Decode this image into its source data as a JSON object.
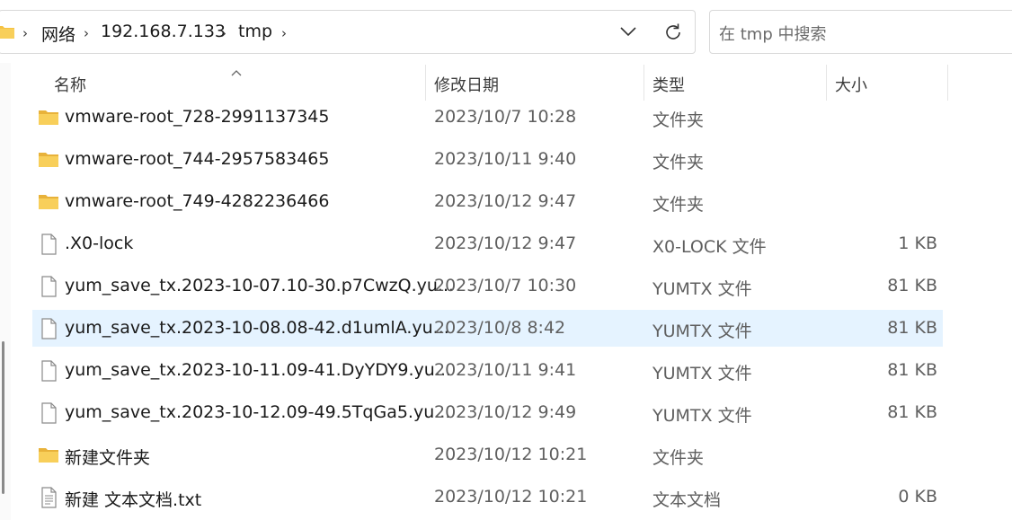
{
  "address": {
    "crumbs": [
      "网络",
      "192.168.7.133",
      "tmp"
    ]
  },
  "search": {
    "placeholder": "在 tmp 中搜索"
  },
  "columns": {
    "name": "名称",
    "date": "修改日期",
    "type": "类型",
    "size": "大小"
  },
  "files": [
    {
      "name": "vmware-root_728-2991137345",
      "date": "2023/10/7 10:28",
      "type": "文件夹",
      "size": "",
      "icon": "folder-icon"
    },
    {
      "name": "vmware-root_744-2957583465",
      "date": "2023/10/11 9:40",
      "type": "文件夹",
      "size": "",
      "icon": "folder-icon"
    },
    {
      "name": "vmware-root_749-4282236466",
      "date": "2023/10/12 9:47",
      "type": "文件夹",
      "size": "",
      "icon": "folder-icon"
    },
    {
      "name": ".X0-lock",
      "date": "2023/10/12 9:47",
      "type": "X0-LOCK 文件",
      "size": "1 KB",
      "icon": "file-icon"
    },
    {
      "name": "yum_save_tx.2023-10-07.10-30.p7CwzQ.yu...",
      "date": "2023/10/7 10:30",
      "type": "YUMTX 文件",
      "size": "81 KB",
      "icon": "file-icon"
    },
    {
      "name": "yum_save_tx.2023-10-08.08-42.d1umlA.yu...",
      "date": "2023/10/8 8:42",
      "type": "YUMTX 文件",
      "size": "81 KB",
      "icon": "file-icon",
      "selected": true
    },
    {
      "name": "yum_save_tx.2023-10-11.09-41.DyYDY9.yu...",
      "date": "2023/10/11 9:41",
      "type": "YUMTX 文件",
      "size": "81 KB",
      "icon": "file-icon"
    },
    {
      "name": "yum_save_tx.2023-10-12.09-49.5TqGa5.yu...",
      "date": "2023/10/12 9:49",
      "type": "YUMTX 文件",
      "size": "81 KB",
      "icon": "file-icon"
    },
    {
      "name": "新建文件夹",
      "date": "2023/10/12 10:21",
      "type": "文件夹",
      "size": "",
      "icon": "folder-icon"
    },
    {
      "name": "新建 文本文档.txt",
      "date": "2023/10/12 10:21",
      "type": "文本文档",
      "size": "0 KB",
      "icon": "text-file-icon"
    }
  ],
  "colors": {
    "selected_row": "#e5f3ff",
    "folder_yellow": "#f5c242",
    "border": "#d9d9d9"
  }
}
